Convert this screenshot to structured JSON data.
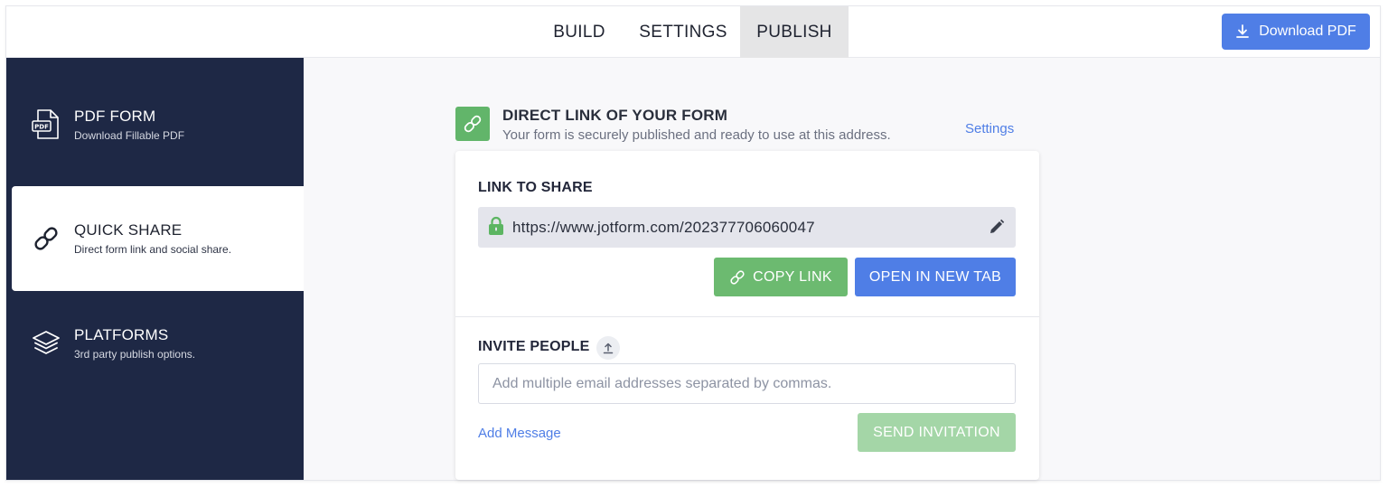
{
  "topbar": {
    "tabs": [
      {
        "label": "BUILD"
      },
      {
        "label": "SETTINGS"
      },
      {
        "label": "PUBLISH",
        "active": true
      }
    ],
    "download_label": "Download PDF"
  },
  "sidebar": {
    "items": [
      {
        "title": "PDF FORM",
        "subtitle": "Download Fillable PDF",
        "icon": "pdf-file-icon"
      },
      {
        "title": "QUICK SHARE",
        "subtitle": "Direct form link and social share.",
        "icon": "link-icon",
        "active": true
      },
      {
        "title": "PLATFORMS",
        "subtitle": "3rd party publish options.",
        "icon": "layers-icon"
      }
    ]
  },
  "direct_link": {
    "title": "DIRECT LINK OF YOUR FORM",
    "subtitle": "Your form is securely published and ready to use at this address.",
    "settings_label": "Settings"
  },
  "share": {
    "label": "LINK TO SHARE",
    "url": "https://www.jotform.com/202377706060047",
    "copy_label": "COPY LINK",
    "open_label": "OPEN IN NEW TAB"
  },
  "invite": {
    "label": "INVITE PEOPLE",
    "placeholder": "Add multiple email addresses separated by commas.",
    "value": "",
    "add_message_label": "Add Message",
    "send_label": "SEND INVITATION"
  },
  "colors": {
    "sidebar_bg": "#1e2845",
    "primary_blue": "#4f7ee6",
    "green": "#6cba70",
    "green_disabled": "#a4d6a7"
  }
}
